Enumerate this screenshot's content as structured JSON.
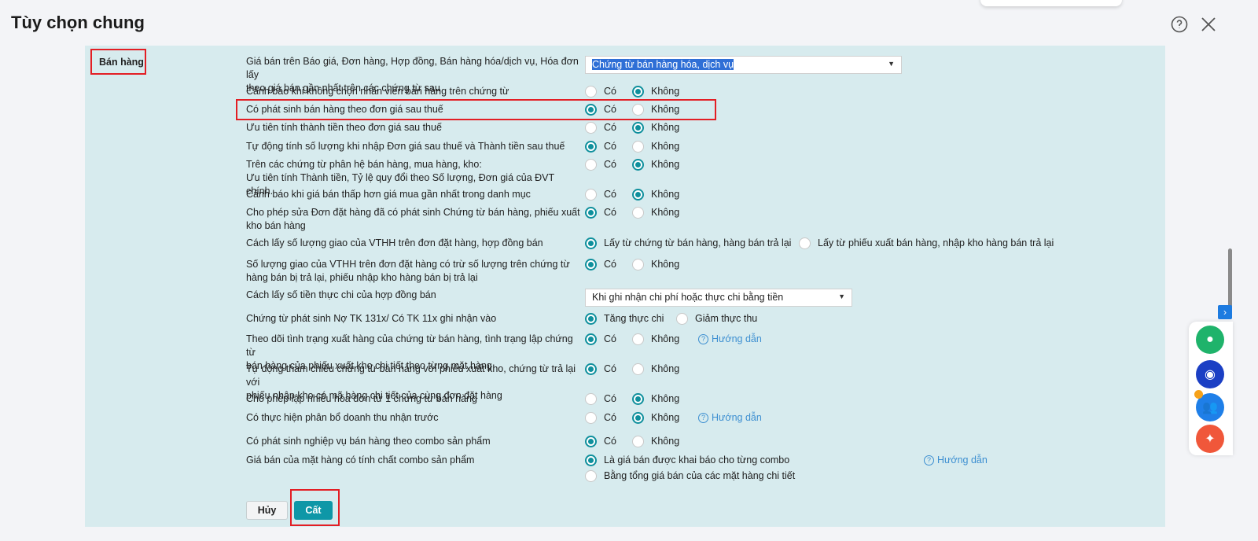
{
  "title": "Tùy chọn chung",
  "section": "Bán hàng",
  "rows": [
    {
      "label": "Giá bán trên Báo giá, Đơn hàng, Hợp đồng, Bán hàng hóa/dịch vụ, Hóa đơn lấy\ntheo giá bán gần nhất trên các chứng từ sau",
      "select": "Chứng từ bán hàng hóa, dịch vụ"
    },
    {
      "label": "Cảnh báo khi không chọn nhân viên bán hàng trên chứng từ",
      "options": [
        "Có",
        "Không"
      ],
      "selected": 1
    },
    {
      "label": "Có phát sinh bán hàng theo đơn giá sau thuế",
      "options": [
        "Có",
        "Không"
      ],
      "selected": 0
    },
    {
      "label": "Ưu tiên tính thành tiền theo đơn giá sau thuế",
      "options": [
        "Có",
        "Không"
      ],
      "selected": 1
    },
    {
      "label": "Tự động tính số lượng khi nhập Đơn giá sau thuế và Thành tiền sau thuế",
      "options": [
        "Có",
        "Không"
      ],
      "selected": 0
    },
    {
      "label": "Trên các chứng từ phân hệ bán hàng, mua hàng, kho:\nƯu tiên tính Thành tiền, Tỷ lệ quy đổi theo Số lượng, Đơn giá của ĐVT chính.",
      "options": [
        "Có",
        "Không"
      ],
      "selected": 1
    },
    {
      "label": "Cảnh báo khi giá bán thấp hơn giá mua gần nhất trong danh mục",
      "options": [
        "Có",
        "Không"
      ],
      "selected": 1
    },
    {
      "label": "Cho phép sửa Đơn đặt hàng đã có phát sinh Chứng từ bán hàng, phiếu xuất\nkho bán hàng",
      "options": [
        "Có",
        "Không"
      ],
      "selected": 0
    },
    {
      "label": "Cách lấy số lượng giao của VTHH trên đơn đặt hàng, hợp đồng bán",
      "options": [
        "Lấy từ chứng từ bán hàng, hàng bán trả lại",
        "Lấy từ phiếu xuất bán hàng, nhập kho hàng bán trả lại"
      ],
      "selected": 0
    },
    {
      "label": "Số lượng giao của VTHH trên đơn đặt hàng có trừ số lượng trên chứng từ\nhàng bán bị trả lại, phiếu nhập kho hàng bán bị trả lại",
      "options": [
        "Có",
        "Không"
      ],
      "selected": 0
    },
    {
      "label": "Cách lấy số tiền thực chi của hợp đồng bán",
      "select": "Khi ghi nhận chi phí hoặc thực chi bằng tiền"
    },
    {
      "label": "Chứng từ phát sinh Nợ TK 131x/ Có TK 11x ghi nhận vào",
      "options": [
        "Tăng thực chi",
        "Giảm thực thu"
      ],
      "selected": 0
    },
    {
      "label": "Theo dõi tình trạng xuất hàng của chứng từ bán hàng, tình trạng lập chứng từ\nbán hàng của phiếu xuất kho chi tiết theo từng mặt hàng",
      "options": [
        "Có",
        "Không"
      ],
      "selected": 0,
      "help": "Hướng dẫn"
    },
    {
      "label": "Tự động tham chiếu chứng từ bán hàng với phiếu xuất kho, chứng từ trả lại với\nphiếu nhập kho có mã hàng chi tiết của cùng đơn đặt hàng",
      "options": [
        "Có",
        "Không"
      ],
      "selected": 0
    },
    {
      "label": "Cho phép lập nhiều hóa đơn từ 1 chứng từ bán hàng",
      "options": [
        "Có",
        "Không"
      ],
      "selected": 1
    },
    {
      "label": "Có thực hiện phân bổ doanh thu nhận trước",
      "options": [
        "Có",
        "Không"
      ],
      "selected": 1,
      "help": "Hướng dẫn"
    },
    {
      "label": "Có phát sinh nghiệp vụ bán hàng theo combo sản phẩm",
      "options": [
        "Có",
        "Không"
      ],
      "selected": 0
    },
    {
      "label": "Giá bán của mặt hàng có tính chất combo sản phẩm",
      "options": [
        "Là giá bán được khai báo cho từng combo",
        "Bằng tổng giá bán của các mặt hàng chi tiết"
      ],
      "selected": 0,
      "help": "Hướng dẫn",
      "stacked": true
    }
  ],
  "buttons": {
    "cancel": "Hủy",
    "save": "Cất"
  },
  "colors": {
    "accent": "#0e97a7",
    "panel": "#d7ebee",
    "highlight": "#e31e24",
    "link": "#3d8fd1"
  }
}
